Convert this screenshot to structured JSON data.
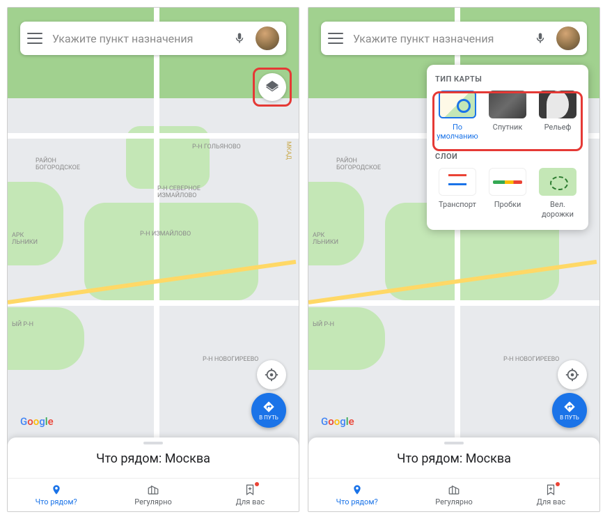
{
  "search": {
    "placeholder": "Укажите пункт назначения"
  },
  "map": {
    "labels": {
      "bogorodskoe": "РАЙОН\nБОГОРОДСКОЕ",
      "golyanovo": "Р-Н ГОЛЬЯНОВО",
      "sev_izmaylovo": "Р-Н СЕВЕРНОЕ\nИЗМАЙЛОВО",
      "izmaylovo": "Р-Н ИЗМАЙЛОВО",
      "novogireevo": "Р-Н НОВОГИРЕЕВО",
      "rayon_left": "ЫЙ Р-Н",
      "park_left": "АРК\nЛЬНИКИ",
      "mkad": "МКАД"
    }
  },
  "logo": "Google",
  "go_label": "В ПУТЬ",
  "sheet": {
    "title": "Что рядом: Москва"
  },
  "nav": {
    "explore": "Что рядом?",
    "commute": "Регулярно",
    "foryou": "Для вас"
  },
  "layers_panel": {
    "heading_maptype": "ТИП КАРТЫ",
    "heading_layers": "СЛОИ",
    "default": "По\nумолчанию",
    "satellite": "Спутник",
    "terrain": "Рельеф",
    "transit": "Транспорт",
    "traffic": "Пробки",
    "bike": "Вел.\nдорожки"
  }
}
